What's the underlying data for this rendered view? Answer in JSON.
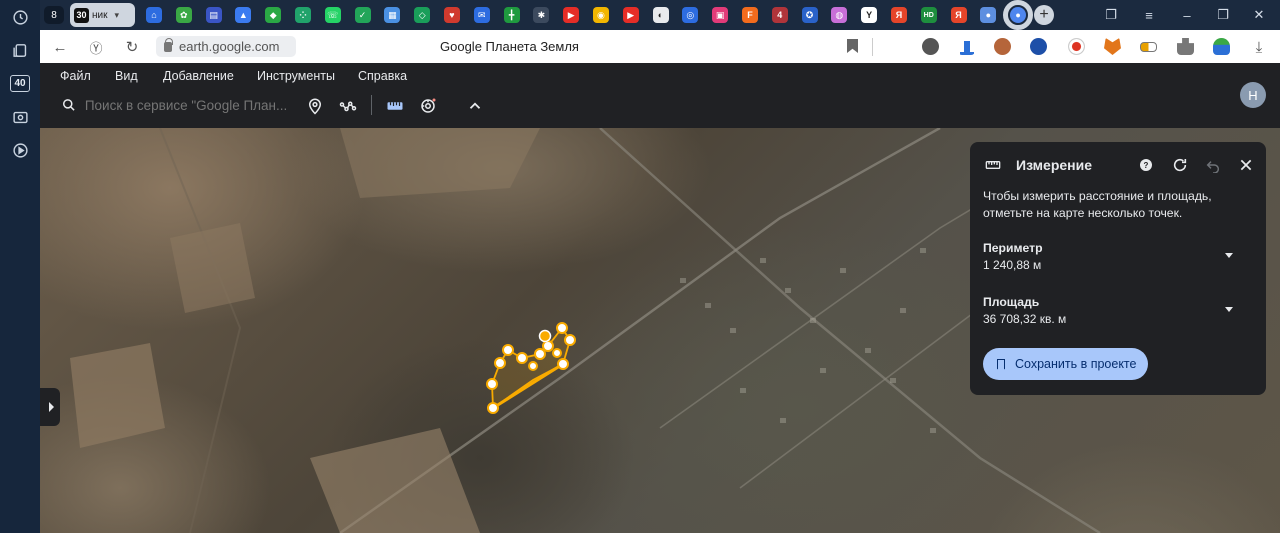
{
  "browser": {
    "tab_count": "8",
    "active_tab": {
      "number": "30",
      "label": "ник"
    },
    "favicons": [
      {
        "name": "home-icon",
        "color": "#2d6ce0",
        "glyph": "⌂"
      },
      {
        "name": "sprout-icon",
        "color": "#3aa845",
        "glyph": "✿"
      },
      {
        "name": "chat-icon",
        "color": "#3a55c5",
        "glyph": "▤"
      },
      {
        "name": "arrow-logo-icon",
        "color": "#3b7bf0",
        "glyph": "▲"
      },
      {
        "name": "green-shield-icon",
        "color": "#2aa845",
        "glyph": "◆"
      },
      {
        "name": "dots-icon",
        "color": "#21a36b",
        "glyph": "⁘"
      },
      {
        "name": "whatsapp-icon",
        "color": "#25d366",
        "glyph": "☏"
      },
      {
        "name": "check-icon",
        "color": "#22a559",
        "glyph": "✓"
      },
      {
        "name": "image-icon",
        "color": "#4a90e2",
        "glyph": "▦"
      },
      {
        "name": "diamond-icon",
        "color": "#1a9e5a",
        "glyph": "◇"
      },
      {
        "name": "heart-icon",
        "color": "#d03a2e",
        "glyph": "♥"
      },
      {
        "name": "mail-icon",
        "color": "#2d6ce0",
        "glyph": "✉"
      },
      {
        "name": "table-icon",
        "color": "#1f9a3f",
        "glyph": "╋"
      },
      {
        "name": "gear-icon",
        "color": "#3c4a5e",
        "glyph": "✱"
      },
      {
        "name": "youtube-icon",
        "color": "#e52d27",
        "glyph": "▶"
      },
      {
        "name": "sheet-icon",
        "color": "#f2b600",
        "glyph": "◉"
      },
      {
        "name": "youtube-icon-2",
        "color": "#e52d27",
        "glyph": "▶"
      },
      {
        "name": "moon-icon",
        "color": "#e8eaed",
        "glyph": "◐"
      },
      {
        "name": "message-icon",
        "color": "#2d6ce0",
        "glyph": "◎"
      },
      {
        "name": "app-icon",
        "color": "#e33b79",
        "glyph": "▣"
      },
      {
        "name": "f-icon",
        "color": "#f26b1d",
        "glyph": "F"
      },
      {
        "name": "notify-icon",
        "color": "#b0343a",
        "glyph": "4"
      },
      {
        "name": "chrome-icon",
        "color": "#2a62c9",
        "glyph": "✪"
      },
      {
        "name": "circle-icon",
        "color": "#c86fd8",
        "glyph": "◍"
      },
      {
        "name": "y-icon",
        "color": "#ffffff",
        "glyph": "Y"
      },
      {
        "name": "yandex-icon",
        "color": "#e5452a",
        "glyph": "Я"
      },
      {
        "name": "hd-icon",
        "color": "#1e8e3e",
        "glyph": "HD"
      },
      {
        "name": "yandex-icon-2",
        "color": "#e5452a",
        "glyph": "Я"
      },
      {
        "name": "globe-icon",
        "color": "#5d8fe0",
        "glyph": "●"
      },
      {
        "name": "earth-tab-icon",
        "color": "#4f86ee",
        "glyph": "●"
      }
    ],
    "url": "earth.google.com",
    "page_title": "Google Планета Земля"
  },
  "earth": {
    "menu": [
      "Файл",
      "Вид",
      "Добавление",
      "Инструменты",
      "Справка"
    ],
    "search_placeholder": "Поиск в сервисе \"Google План...",
    "avatar_letter": "H"
  },
  "measure": {
    "title": "Измерение",
    "hint": "Чтобы измерить расстояние и площадь, отметьте на карте несколько точек.",
    "perimeter_label": "Периметр",
    "perimeter_value": "1 240,88 м",
    "area_label": "Площадь",
    "area_value": "36 708,32 кв. м",
    "save_label": "Сохранить в проекте",
    "accent": "#f9ab00"
  }
}
